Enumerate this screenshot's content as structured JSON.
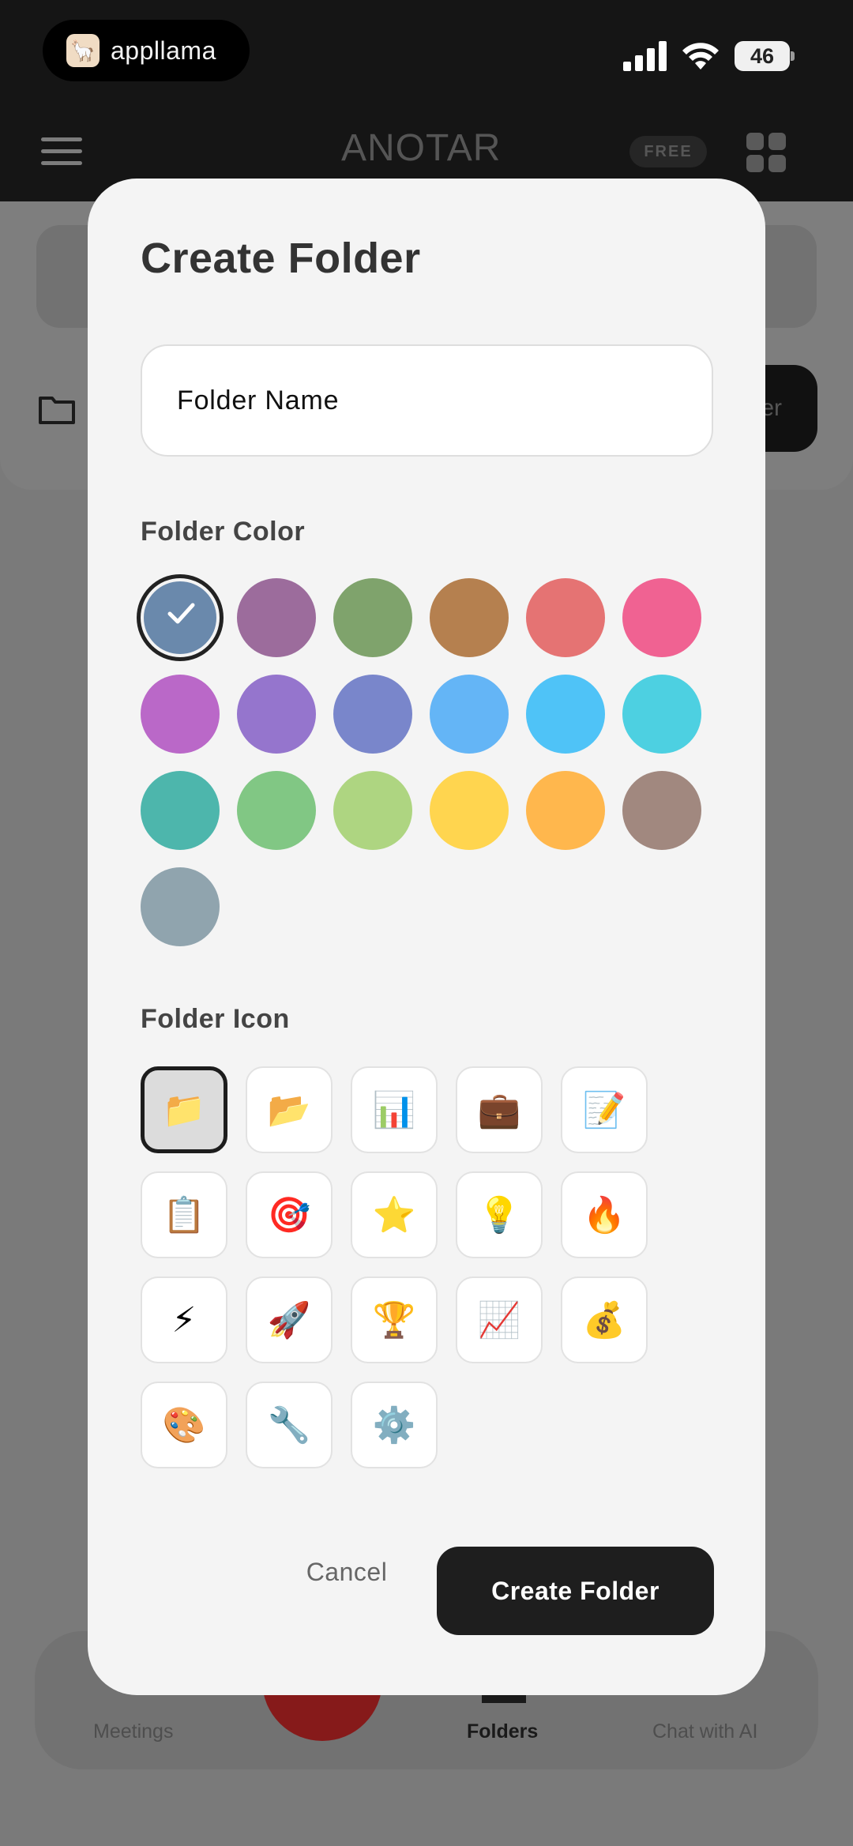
{
  "status_bar": {
    "app_pill_label": "appllama",
    "battery": "46"
  },
  "header": {
    "brand": "ANOTAR",
    "plan_badge": "FREE"
  },
  "background": {
    "new_button_fragment": "er"
  },
  "bottom_nav": {
    "items": [
      {
        "label": "Meetings",
        "active": false
      },
      {
        "label": "Folders",
        "active": true
      },
      {
        "label": "Chat with AI",
        "active": false
      }
    ]
  },
  "modal": {
    "title": "Create Folder",
    "name_placeholder": "Folder Name",
    "color_label": "Folder Color",
    "colors": [
      "#6a89ac",
      "#9c6c9c",
      "#7fa36c",
      "#b5804f",
      "#e57373",
      "#f06292",
      "#ba68c8",
      "#9575cd",
      "#7986cb",
      "#64b5f6",
      "#4fc3f7",
      "#4dd0e1",
      "#4db6ac",
      "#81c784",
      "#aed581",
      "#ffd54f",
      "#ffb74d",
      "#a1887f",
      "#90a4ae"
    ],
    "selected_color": "#6a89ac",
    "icon_label": "Folder Icon",
    "icons": [
      {
        "name": "folder",
        "glyph": "📁"
      },
      {
        "name": "open-folder",
        "glyph": "📂"
      },
      {
        "name": "bar-chart",
        "glyph": "📊"
      },
      {
        "name": "briefcase",
        "glyph": "💼"
      },
      {
        "name": "memo",
        "glyph": "📝"
      },
      {
        "name": "clipboard",
        "glyph": "📋"
      },
      {
        "name": "target",
        "glyph": "🎯"
      },
      {
        "name": "star",
        "glyph": "⭐"
      },
      {
        "name": "light-bulb",
        "glyph": "💡"
      },
      {
        "name": "fire",
        "glyph": "🔥"
      },
      {
        "name": "lightning",
        "glyph": "⚡"
      },
      {
        "name": "rocket",
        "glyph": "🚀"
      },
      {
        "name": "trophy",
        "glyph": "🏆"
      },
      {
        "name": "chart-increasing",
        "glyph": "📈"
      },
      {
        "name": "money-bag",
        "glyph": "💰"
      },
      {
        "name": "palette",
        "glyph": "🎨"
      },
      {
        "name": "wrench",
        "glyph": "🔧"
      },
      {
        "name": "gear",
        "glyph": "⚙️"
      }
    ],
    "selected_icon": "folder",
    "cancel_label": "Cancel",
    "create_label": "Create Folder"
  }
}
